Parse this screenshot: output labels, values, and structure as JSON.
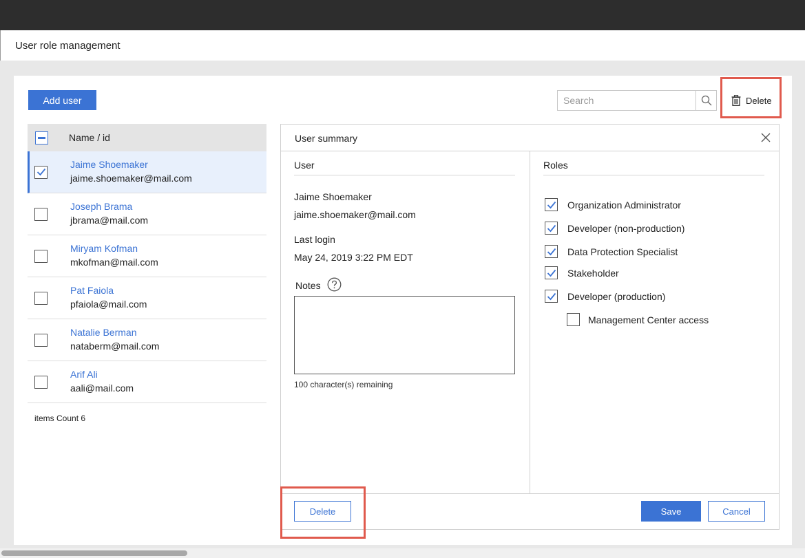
{
  "page": {
    "title": "User role management"
  },
  "toolbar": {
    "add_user_label": "Add user",
    "search_placeholder": "Search",
    "delete_label": "Delete"
  },
  "list": {
    "header": "Name / id",
    "users": [
      {
        "name": "Jaime Shoemaker",
        "email": "jaime.shoemaker@mail.com",
        "checked": true
      },
      {
        "name": "Joseph Brama",
        "email": "jbrama@mail.com",
        "checked": false
      },
      {
        "name": "Miryam Kofman",
        "email": "mkofman@mail.com",
        "checked": false
      },
      {
        "name": "Pat Faiola",
        "email": "pfaiola@mail.com",
        "checked": false
      },
      {
        "name": "Natalie Berman",
        "email": "nataberm@mail.com",
        "checked": false
      },
      {
        "name": "Arif Ali",
        "email": "aali@mail.com",
        "checked": false
      }
    ],
    "items_count_label": "items Count 6"
  },
  "summary": {
    "title": "User summary",
    "user_section_title": "User",
    "user_name": "Jaime Shoemaker",
    "user_email": "jaime.shoemaker@mail.com",
    "last_login_label": "Last login",
    "last_login_value": "May 24, 2019 3:22 PM EDT",
    "notes_label": "Notes",
    "notes_value": "",
    "remaining_text": "100 character(s) remaining",
    "roles_section_title": "Roles",
    "roles": [
      {
        "label": "Organization Administrator",
        "checked": true,
        "indent": false
      },
      {
        "label": "Developer (non-production)",
        "checked": true,
        "indent": false
      },
      {
        "label": "Data Protection Specialist",
        "checked": true,
        "indent": false
      },
      {
        "label": "Stakeholder",
        "checked": true,
        "indent": false
      },
      {
        "label": "Developer (production)",
        "checked": true,
        "indent": false
      },
      {
        "label": "Management Center access",
        "checked": false,
        "indent": true
      }
    ],
    "delete_label": "Delete",
    "save_label": "Save",
    "cancel_label": "Cancel"
  },
  "colors": {
    "accent": "#3b73d4",
    "highlight": "#e05a4d",
    "topbar": "#2d2d2d"
  }
}
